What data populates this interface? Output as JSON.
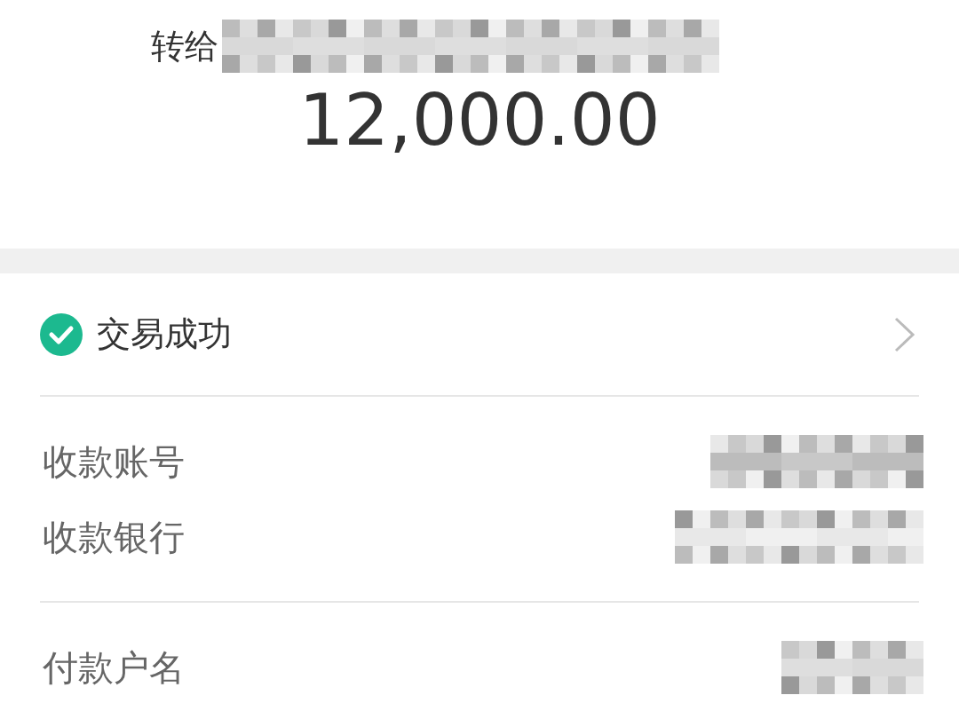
{
  "header": {
    "recipient_label": "转给",
    "recipient_redacted": true,
    "amount": "12,000.00"
  },
  "status": {
    "text": "交易成功",
    "success": true
  },
  "groups": [
    {
      "rows": [
        {
          "label": "收款账号",
          "redacted": true
        },
        {
          "label": "收款银行",
          "redacted": true
        }
      ]
    },
    {
      "rows": [
        {
          "label": "付款户名",
          "redacted": true
        }
      ]
    }
  ]
}
